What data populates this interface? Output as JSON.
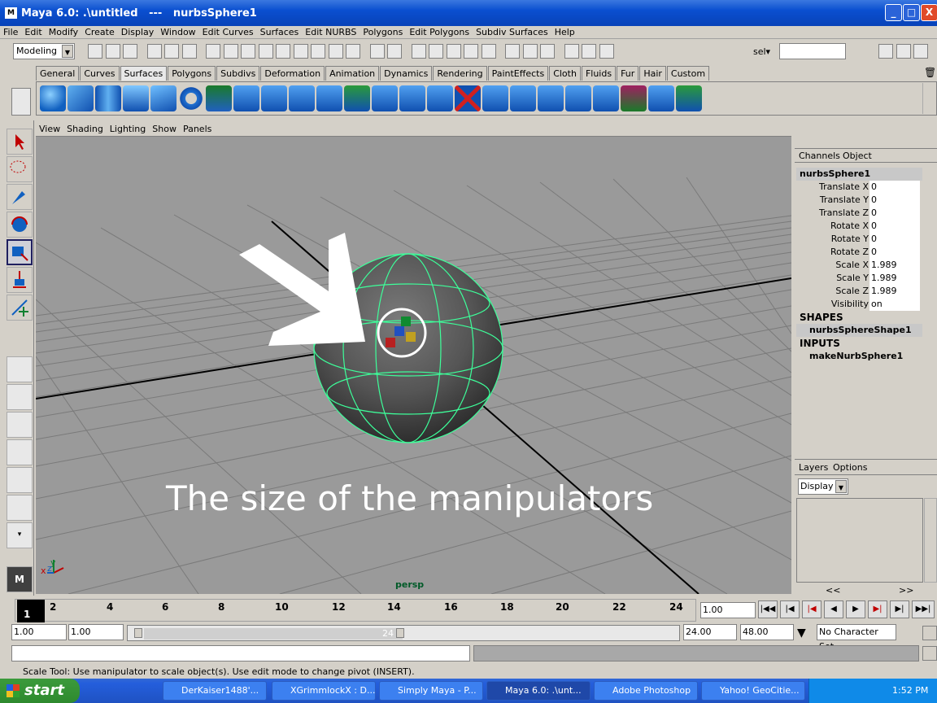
{
  "window": {
    "title": "Maya 6.0: .\\untitled   ---   nurbsSphere1",
    "logo": "M",
    "buttons": [
      "_",
      "□",
      "X"
    ]
  },
  "menu": [
    "File",
    "Edit",
    "Modify",
    "Create",
    "Display",
    "Window",
    "Edit Curves",
    "Surfaces",
    "Edit NURBS",
    "Polygons",
    "Edit Polygons",
    "Subdiv Surfaces",
    "Help"
  ],
  "statusline": {
    "mode": "Modeling",
    "sel_label": "sel▾",
    "sel_value": ""
  },
  "shelf_tabs": [
    "General",
    "Curves",
    "Surfaces",
    "Polygons",
    "Subdivs",
    "Deformation",
    "Animation",
    "Dynamics",
    "Rendering",
    "PaintEffects",
    "Cloth",
    "Fluids",
    "Fur",
    "Hair",
    "Custom"
  ],
  "shelf_active": "Surfaces",
  "viewport": {
    "menu": [
      "View",
      "Shading",
      "Lighting",
      "Show",
      "Panels"
    ],
    "caption": "The size of the manipulators",
    "camera": "persp",
    "axis": {
      "x": "x",
      "y": "y",
      "z": "z"
    }
  },
  "channelbox": {
    "tabs": [
      "Channels",
      "Object"
    ],
    "object": "nurbsSphere1",
    "channels": [
      {
        "label": "Translate X",
        "value": "0"
      },
      {
        "label": "Translate Y",
        "value": "0"
      },
      {
        "label": "Translate Z",
        "value": "0"
      },
      {
        "label": "Rotate X",
        "value": "0"
      },
      {
        "label": "Rotate Y",
        "value": "0"
      },
      {
        "label": "Rotate Z",
        "value": "0"
      },
      {
        "label": "Scale X",
        "value": "1.989"
      },
      {
        "label": "Scale Y",
        "value": "1.989"
      },
      {
        "label": "Scale Z",
        "value": "1.989"
      },
      {
        "label": "Visibility",
        "value": "on"
      }
    ],
    "shapes_header": "SHAPES",
    "shape": "nurbsSphereShape1",
    "inputs_header": "INPUTS",
    "input": "makeNurbSphere1"
  },
  "layers": {
    "tabs": [
      "Layers",
      "Options"
    ],
    "display": "Display",
    "scroll_left": "<<",
    "scroll_right": ">>"
  },
  "timeline": {
    "ticks": [
      "2",
      "4",
      "6",
      "8",
      "10",
      "12",
      "14",
      "16",
      "18",
      "20",
      "22",
      "24"
    ],
    "current": "1",
    "current_field": "1.00"
  },
  "range": {
    "start": "1.00",
    "playstart": "1.00",
    "slider_end": "24",
    "playend": "24.00",
    "end": "48.00",
    "charset": "No Character Set"
  },
  "help": "Scale Tool: Use manipulator to scale object(s). Use edit mode to change pivot (INSERT).",
  "taskbar": {
    "start": "start",
    "tasks": [
      "DerKaiser1488'...",
      "XGrimmlockX : D...",
      "Simply Maya - P...",
      "Maya 6.0: .\\unt...",
      "Adobe Photoshop",
      "Yahoo! GeoCitie..."
    ],
    "active_task": 3,
    "clock": "1:52 PM"
  }
}
